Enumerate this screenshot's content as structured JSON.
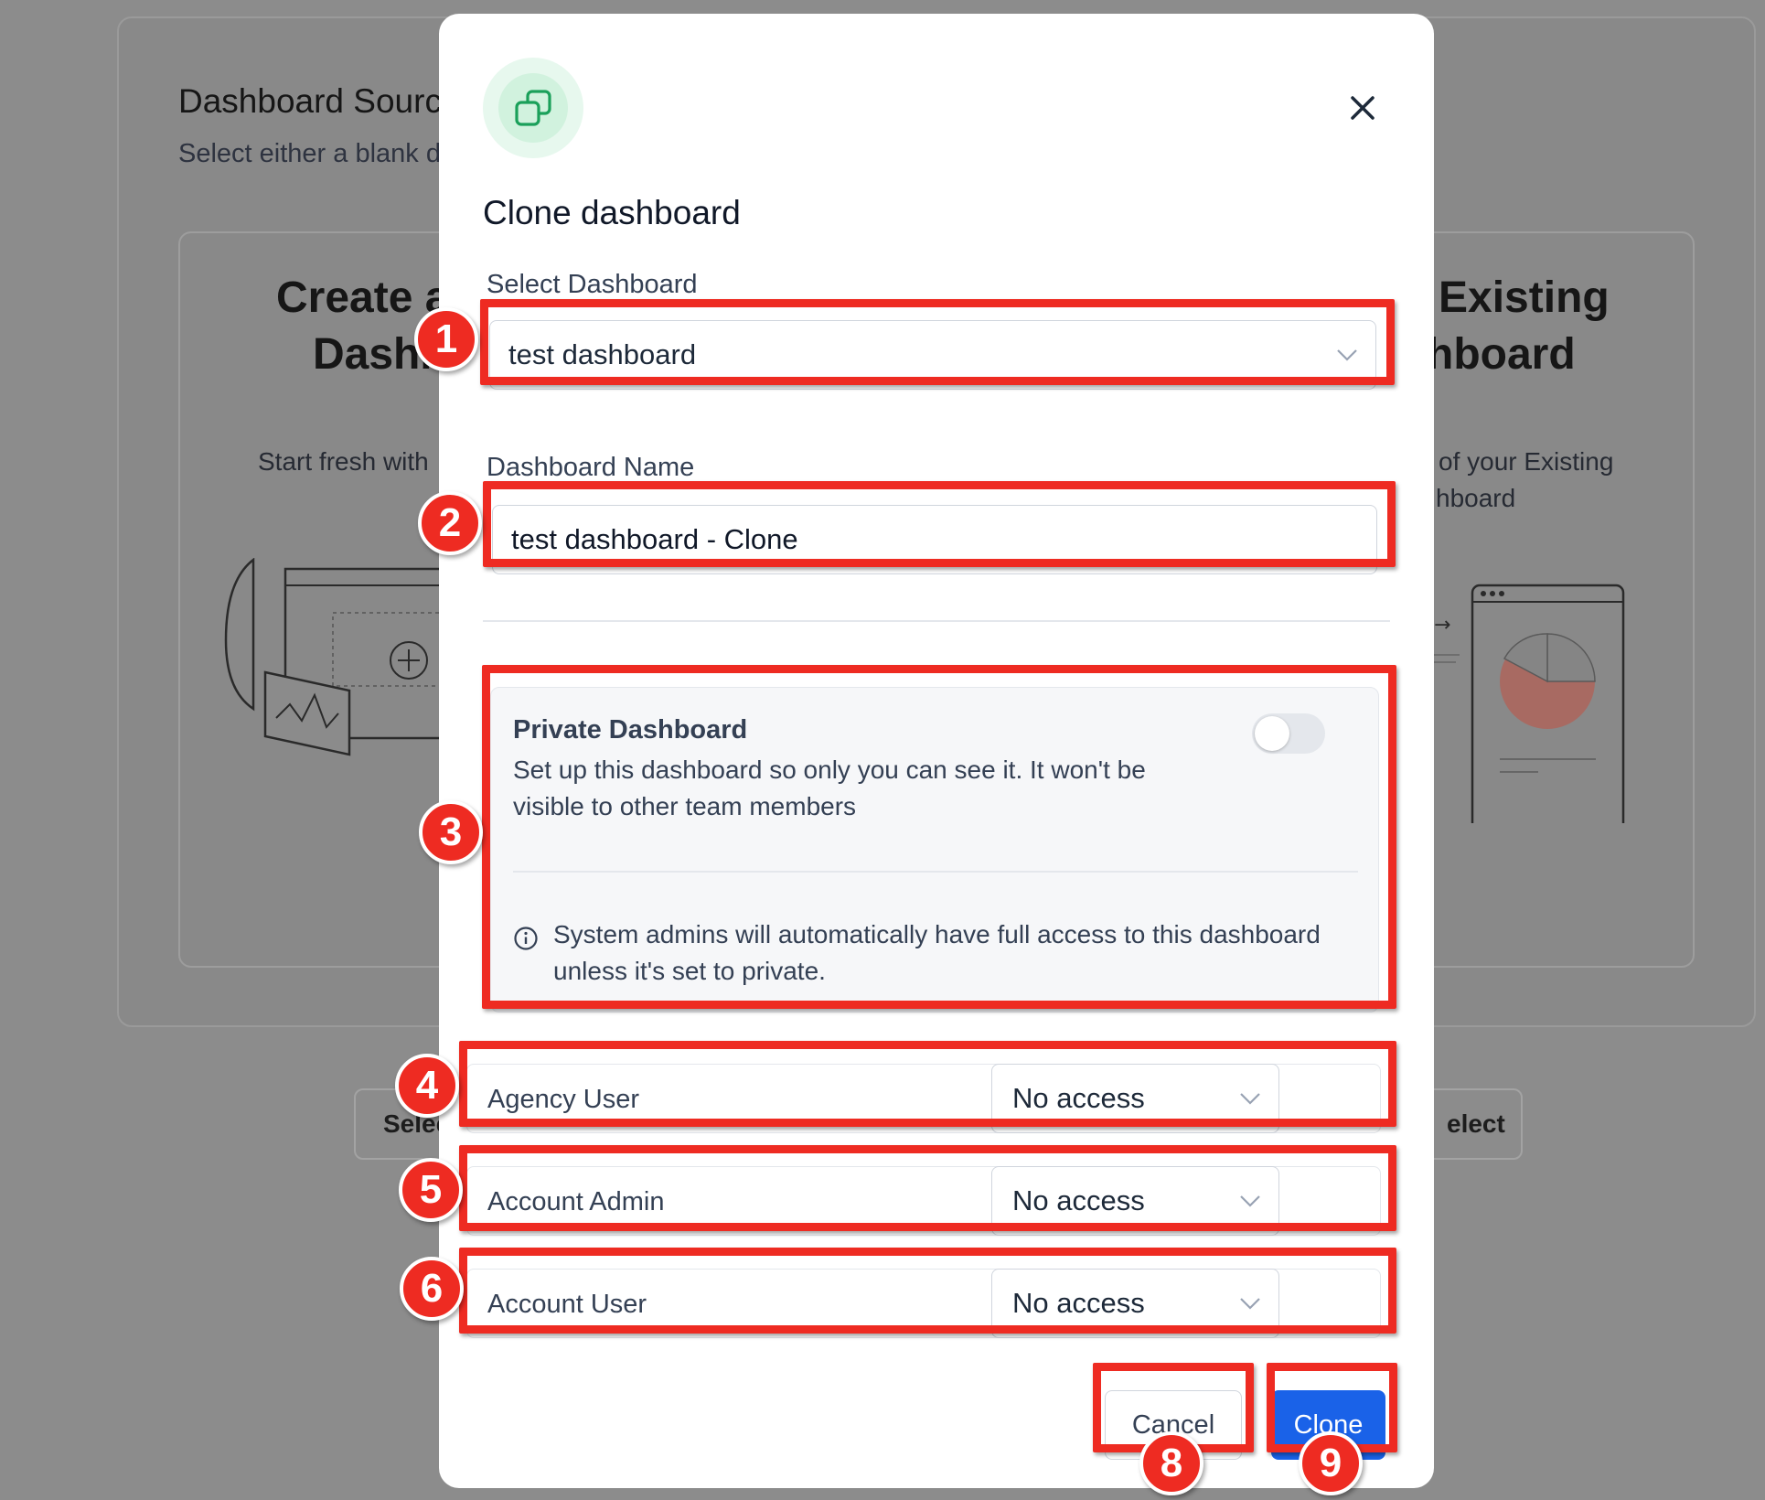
{
  "background": {
    "title": "Dashboard Sourc",
    "subtitle": "Select either a blank d",
    "left_card": {
      "title_line1": "Create a",
      "title_line2": "Dashb",
      "text": "Start fresh with",
      "button": "Selec"
    },
    "right_card": {
      "title_line1": "Existing",
      "title_line2": "hboard",
      "text_line1": "of your Existing",
      "text_line2": "hboard",
      "button": "elect"
    }
  },
  "modal": {
    "icon": "copy-icon",
    "title": "Clone dashboard",
    "select_dashboard": {
      "label": "Select Dashboard",
      "value": "test dashboard"
    },
    "dashboard_name": {
      "label": "Dashboard Name",
      "value": "test dashboard - Clone"
    },
    "private": {
      "title": "Private Dashboard",
      "description": "Set up this dashboard so only you can see it. It won't be visible to other team members",
      "enabled": false,
      "info": "System admins will automatically have full access to this dashboard unless it's set to private."
    },
    "permissions": [
      {
        "role": "Agency User",
        "access": "No access"
      },
      {
        "role": "Account Admin",
        "access": "No access"
      },
      {
        "role": "Account User",
        "access": "No access"
      }
    ],
    "cancel_label": "Cancel",
    "clone_label": "Clone"
  },
  "annotations": [
    "1",
    "2",
    "3",
    "4",
    "5",
    "6",
    "8",
    "9"
  ],
  "colors": {
    "accent": "#1a62e8",
    "annotation": "#ee2b22",
    "icon_green": "#1aa05a"
  }
}
